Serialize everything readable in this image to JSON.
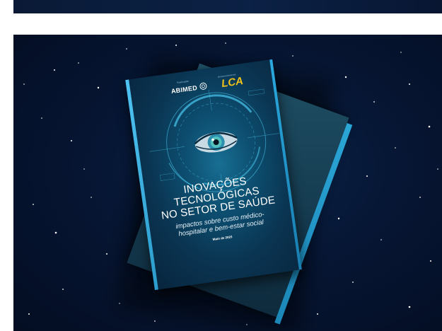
{
  "top_banner": {
    "color": "#0b2145"
  },
  "hero": {
    "background": "#061634",
    "book": {
      "logos": {
        "caption_left": "Realização",
        "caption_right": "Desenvolvimento",
        "abimed": "ABIMED",
        "lca": "LCA"
      },
      "title_lines": [
        "INOVAÇÕES",
        "TECNOLÓGICAS",
        "NO SETOR DE SAÚDE"
      ],
      "subtitle_lines": [
        "impactos sobre custo médico-",
        "hospitalar e bem-estar social"
      ],
      "date": "Maio de 2023",
      "accent_color": "#2ba9de",
      "logo_accent_color": "#f2c21b"
    }
  }
}
